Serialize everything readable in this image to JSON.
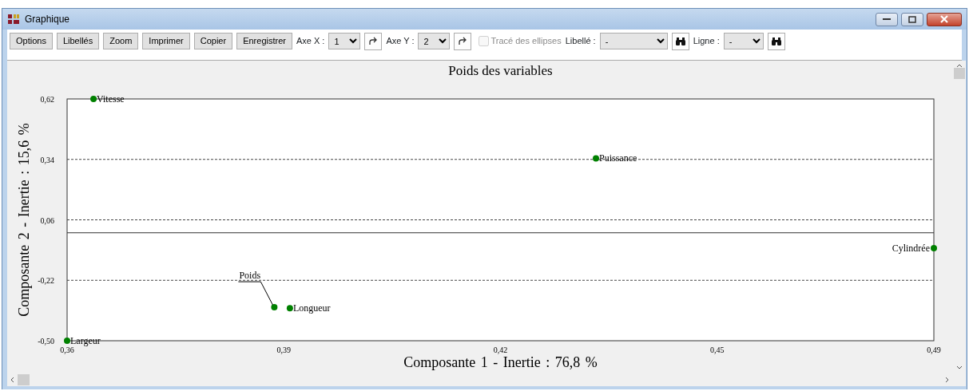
{
  "window": {
    "title": "Graphique"
  },
  "toolbar": {
    "buttons": [
      "Options",
      "Libellés",
      "Zoom",
      "Imprimer",
      "Copier",
      "Enregistrer"
    ],
    "axis_x": {
      "label": "Axe X :",
      "value": "1"
    },
    "axis_y": {
      "label": "Axe Y :",
      "value": "2"
    },
    "ellipses": {
      "label": "Tracé des ellipses",
      "checked": false,
      "disabled": true
    },
    "label_filter": {
      "label": "Libellé :",
      "value": "-"
    },
    "line_filter": {
      "label": "Ligne :",
      "value": "-"
    }
  },
  "chart": {
    "chart_data": {
      "type": "scatter",
      "title": "Poids des variables",
      "xlabel": "Composante 1 - Inertie : 76,8 %",
      "ylabel": "Composante 2 - Inertie : 15,6 %",
      "x": [
        0.3619,
        0.4361,
        0.486,
        0.3886,
        0.3909,
        0.358
      ],
      "series": [
        {
          "color": "#008000",
          "values": [
            0.62,
            0.345,
            -0.071,
            -0.345,
            -0.349,
            -0.5
          ]
        }
      ],
      "xlim": [
        0.358,
        0.486
      ],
      "ylim": [
        -0.5,
        0.62
      ],
      "grid": true,
      "xticks": [
        {
          "value": 0.358,
          "label": "0,36"
        },
        {
          "value": 0.39,
          "label": "0,39"
        },
        {
          "value": 0.422,
          "label": "0,42"
        },
        {
          "value": 0.454,
          "label": "0,45"
        },
        {
          "value": 0.486,
          "label": "0,49"
        }
      ],
      "yticks": [
        {
          "value": 0.62,
          "label": "0,62"
        },
        {
          "value": 0.34,
          "label": "0,34"
        },
        {
          "value": 0.06,
          "label": "0,06"
        },
        {
          "value": -0.22,
          "label": "-0,22"
        },
        {
          "value": -0.5,
          "label": "-0,50"
        }
      ],
      "annotations": [
        {
          "text": "Vitesse",
          "x": 0.3619,
          "y": 0.62
        },
        {
          "text": "Puissance",
          "x": 0.4361,
          "y": 0.345
        },
        {
          "text": "Cylindrée",
          "x": 0.486,
          "y": -0.071
        },
        {
          "text": "Poids",
          "x": 0.3886,
          "y": -0.345
        },
        {
          "text": "Longueur",
          "x": 0.3909,
          "y": -0.349
        },
        {
          "text": "Largeur",
          "x": 0.358,
          "y": -0.5
        }
      ]
    }
  }
}
